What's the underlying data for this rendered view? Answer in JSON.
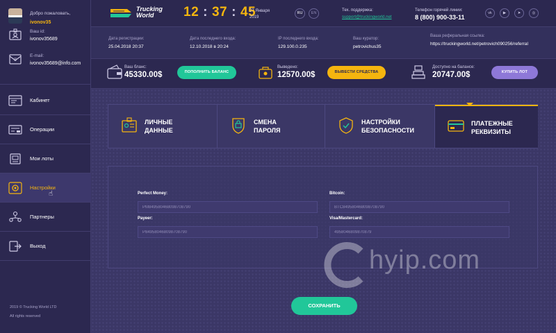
{
  "sidebar": {
    "welcome": "Добро пожаловать,",
    "username": "ivonov35",
    "user_id_label": "Ваш id:",
    "user_id": "ivonov35689",
    "email_label": "E-mail:",
    "email": "ivonov35689@info.com",
    "nav": [
      {
        "label": "Кабинет",
        "icon": "cabinet-icon"
      },
      {
        "label": "Операции",
        "icon": "operations-icon"
      },
      {
        "label": "Мои лоты",
        "icon": "lots-icon"
      },
      {
        "label": "Настройки",
        "icon": "settings-icon",
        "active": true
      },
      {
        "label": "Партнеры",
        "icon": "partners-icon"
      },
      {
        "label": "Выход",
        "icon": "exit-icon"
      }
    ],
    "copyright_1": "2019 © Trucking World LTD",
    "copyright_2": "All rights reserved"
  },
  "header": {
    "logo_line1": "Trucking",
    "logo_line2": "World",
    "clock_h": "12",
    "clock_m": "37",
    "clock_s": "45",
    "date_1": "27 Января",
    "date_2": "2019",
    "lang_ru": "RU",
    "lang_en": "EN",
    "support_label": "Тех. поддержка:",
    "support_email": "support@truckingworld.net",
    "hotline_label": "Телефон горячей линии:",
    "hotline": "8 (800) 900-33-11",
    "social": [
      "vk",
      "yt",
      "tg",
      "ig"
    ]
  },
  "info": {
    "reg_label": "Дата регистрации:",
    "reg_value": "25.04.2018  20:37",
    "last_login_label": "Дата последнего входа:",
    "last_login_value": "12.10.2018 в 20:24",
    "ip_label": "IP последнего входа:",
    "ip_value": "129.100.0.235",
    "curator_label": "Ваш куратор:",
    "curator_value": "petrovichus35",
    "ref_label": "Ваша реферальная ссылка:",
    "ref_value": "https://truckingworld.net/petrovich090256/referral"
  },
  "balance": {
    "balance_label": "Ваш бланс:",
    "balance_value": "45330.00$",
    "topup_btn": "ПОПОЛНИТЬ БАЛАНС",
    "withdrawn_label": "Выведено:",
    "withdrawn_value": "12570.00$",
    "withdraw_btn": "ВЫВЕСТИ СРЕДСТВА",
    "available_label": "Доступно на балансе:",
    "available_value": "20747.00$",
    "buy_btn": "КУПИТЬ ЛОТ"
  },
  "tabs": [
    {
      "line1": "Личные",
      "line2": "данные",
      "icon": "personal-data-icon"
    },
    {
      "line1": "Смена",
      "line2": "пароля",
      "icon": "password-icon"
    },
    {
      "line1": "Настройки",
      "line2": "безопасности",
      "icon": "security-icon"
    },
    {
      "line1": "Платежные",
      "line2": "реквизиты",
      "icon": "payment-card-icon",
      "active": true
    }
  ],
  "form": {
    "pm_label": "Perfect Money:",
    "pm_value": "PM849580468098708790",
    "btc_label": "Bitcoin:",
    "btc_value": "BTC849580468098708790",
    "payeer_label": "Payeer:",
    "payeer_value": "P849580468098708790",
    "visa_label": "Visa/Mastercard:",
    "visa_value": "4958046809870879",
    "save": "СОХРАНИТЬ"
  },
  "watermark": "hyip.com",
  "colors": {
    "accent_yellow": "#f5b50f",
    "accent_green": "#21c799",
    "accent_purple": "#8e78d8",
    "bg_dark": "#2c2850",
    "bg_main": "#3b3766"
  }
}
